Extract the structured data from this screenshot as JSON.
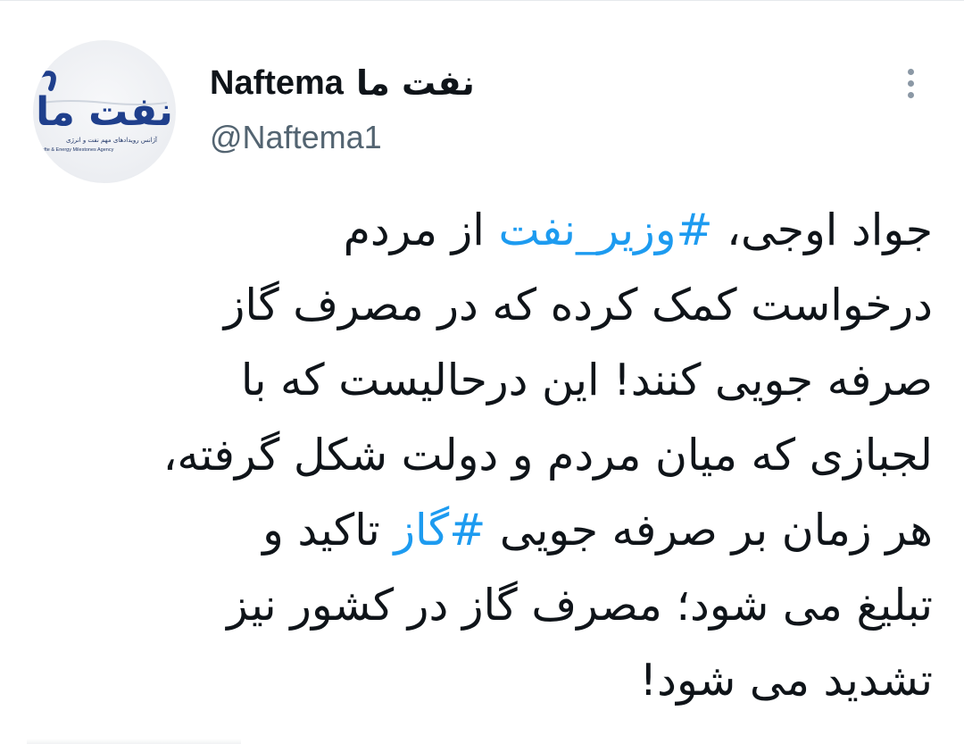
{
  "author": {
    "name_fa": "نفت ما",
    "name_en": "Naftema",
    "handle": "@Naftema1",
    "avatar": {
      "icon": "naftema-logo",
      "logo_text_fa": "نفت ما",
      "tagline_fa": "آژانس رویدادهای مهم نفت و انرژی",
      "tagline_en": "Nafte & Energy Milestones Agency",
      "colors": {
        "logo": "#1f3f8c",
        "background": "#eceef2"
      }
    }
  },
  "menu": {
    "icon": "more-vertical-icon"
  },
  "tweet": {
    "lines": [
      {
        "parts": [
          {
            "t": "جواد اوجی، "
          },
          {
            "t": "#وزیر_نفت",
            "hashtag": true
          },
          {
            "t": " از مردم"
          }
        ]
      },
      {
        "parts": [
          {
            "t": "درخواست کمک کرده که در مصرف گاز"
          }
        ]
      },
      {
        "parts": [
          {
            "t": "صرفه جویی کنند! این درحالیست که با"
          }
        ]
      },
      {
        "parts": [
          {
            "t": "لجبازی که میان مردم و دولت شکل گرفته،"
          }
        ]
      },
      {
        "parts": [
          {
            "t": "هر زمان بر صرفه جویی "
          },
          {
            "t": "#گاز",
            "hashtag": true
          },
          {
            "t": " تاکید و"
          }
        ]
      },
      {
        "parts": [
          {
            "t": "تبلیغ می شود؛ مصرف گاز در کشور نیز"
          }
        ]
      },
      {
        "parts": [
          {
            "t": "تشدید می شود!"
          }
        ]
      }
    ]
  },
  "colors": {
    "text": "#0f1419",
    "hashtag": "#1d9bf0",
    "secondary": "#536471",
    "icon": "#8b98a5"
  }
}
